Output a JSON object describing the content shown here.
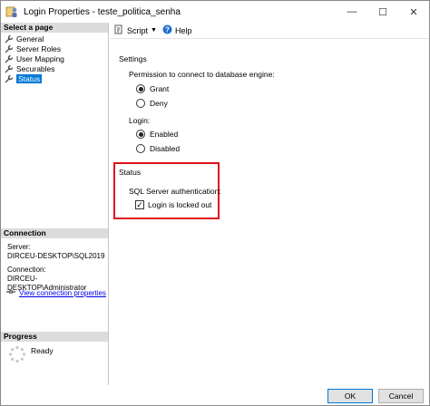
{
  "window": {
    "title": "Login Properties - teste_politica_senha",
    "controls": {
      "minimize": "—",
      "maximize": "☐",
      "close": "✕"
    }
  },
  "left": {
    "select_page_header": "Select a page",
    "pages": [
      {
        "label": "General",
        "selected": false
      },
      {
        "label": "Server Roles",
        "selected": false
      },
      {
        "label": "User Mapping",
        "selected": false
      },
      {
        "label": "Securables",
        "selected": false
      },
      {
        "label": "Status",
        "selected": true
      }
    ],
    "connection_header": "Connection",
    "server_label": "Server:",
    "server_value": "DIRCEU-DESKTOP\\SQL2019",
    "connection_label": "Connection:",
    "connection_value": "DIRCEU-DESKTOP\\Administrator",
    "view_link": "View connection properties",
    "progress_header": "Progress",
    "progress_status": "Ready"
  },
  "toolbar": {
    "script_label": "Script",
    "help_label": "Help"
  },
  "main": {
    "settings_label": "Settings",
    "permission_label": "Permission to connect to database engine:",
    "grant_label": "Grant",
    "deny_label": "Deny",
    "permission_value": "Grant",
    "login_label": "Login:",
    "enabled_label": "Enabled",
    "disabled_label": "Disabled",
    "login_value": "Enabled",
    "status_label": "Status",
    "sql_auth_label": "SQL Server authentication:",
    "locked_out_label": "Login is locked out",
    "locked_out_checked": true
  },
  "buttons": {
    "ok": "OK",
    "cancel": "Cancel"
  },
  "colors": {
    "selection": "#0078d7",
    "highlight_box": "#e0101a",
    "link": "#0000ee"
  },
  "icons": {
    "app": "database-login-icon",
    "page": "wrench-icon",
    "script": "script-icon",
    "help": "help-icon",
    "connection": "connection-icon",
    "progress": "spinner-icon"
  }
}
